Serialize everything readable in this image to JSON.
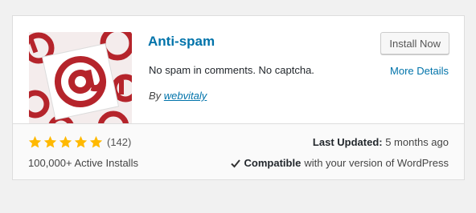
{
  "plugin": {
    "name": "Anti-spam",
    "description": "No spam in comments. No captcha.",
    "author_prefix": "By",
    "author": "webvitaly",
    "icon": "at-sign-logo-icon"
  },
  "actions": {
    "install_label": "Install Now",
    "more_details_label": "More Details"
  },
  "stats": {
    "rating_stars": 5,
    "rating_max": 5,
    "rating_count": "(142)",
    "active_installs": "100,000+ Active Installs",
    "last_updated_label": "Last Updated:",
    "last_updated_value": "5 months ago",
    "compatible_label": "Compatible",
    "compatible_text": "with your version of WordPress"
  },
  "colors": {
    "link": "#0073aa",
    "star": "#ffb900",
    "logo_red": "#b5242b"
  }
}
